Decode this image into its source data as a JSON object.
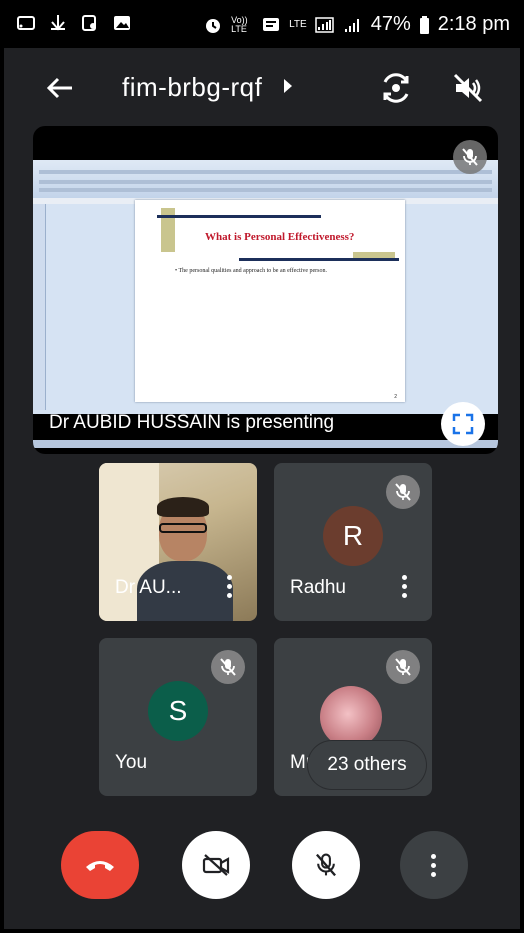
{
  "status_bar": {
    "time": "2:18 pm",
    "battery": "47%",
    "network_tags": [
      "Vo)) LTE",
      "LTE"
    ],
    "icons": [
      "cast-icon",
      "usb-icon",
      "screen-record-icon",
      "image-icon",
      "alarm-icon",
      "volte-icon",
      "messages-icon",
      "lte-icon",
      "signal-icon",
      "battery-icon"
    ]
  },
  "header": {
    "meeting_code": "fim-brbg-rqf",
    "icons": [
      "back-arrow-icon",
      "switch-camera-icon",
      "speaker-off-icon"
    ]
  },
  "presentation": {
    "presenter_text": "Dr AUBID HUSSAIN is presenting",
    "slide_title": "What is Personal Effectiveness?",
    "slide_bullet": "The personal qualities and approach to be an effective person.",
    "slide_page": "2",
    "icons": [
      "mic-off-icon",
      "fullscreen-icon"
    ]
  },
  "participants": [
    {
      "name": "Dr AU...",
      "type": "video",
      "muted": false
    },
    {
      "name": "Radhu",
      "initial": "R",
      "avatar_color": "#6b3d2e",
      "muted": true
    },
    {
      "name": "You",
      "initial": "S",
      "avatar_color": "#0b5e4a",
      "muted": true
    },
    {
      "name": "Mu",
      "type": "photo",
      "muted": true
    }
  ],
  "others_pill": "23 others",
  "controls": {
    "end_call_color": "#ea4335",
    "icons": [
      "end-call-icon",
      "camera-off-icon",
      "mic-off-icon",
      "more-options-icon"
    ]
  }
}
